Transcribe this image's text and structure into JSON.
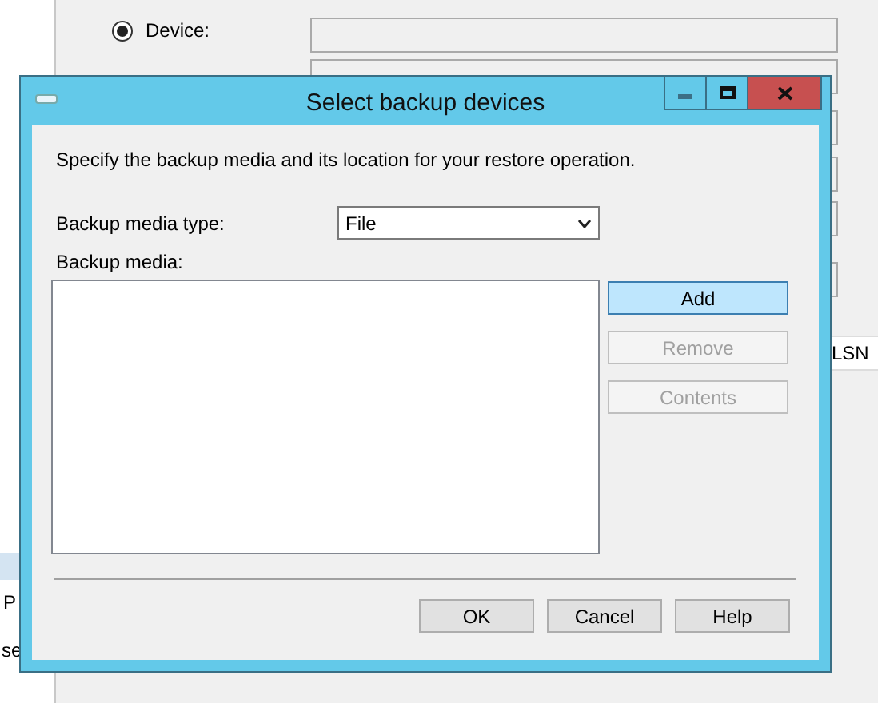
{
  "background": {
    "radio": {
      "label": "Device:",
      "selected": true
    },
    "fragments": [
      {
        "kind": "left",
        "text": "P"
      },
      {
        "kind": "left",
        "text": "se"
      },
      {
        "kind": "header",
        "text": "LSN"
      }
    ]
  },
  "dialog": {
    "title": "Select backup devices",
    "description": "Specify the backup media and its location for your restore operation.",
    "media_type": {
      "label": "Backup media type:",
      "value": "File"
    },
    "media_list": {
      "label": "Backup media:"
    },
    "side_buttons": [
      {
        "label": "Add",
        "disabled": false,
        "highlighted": true
      },
      {
        "label": "Remove",
        "disabled": true,
        "highlighted": false
      },
      {
        "label": "Contents",
        "disabled": true,
        "highlighted": false
      }
    ],
    "footer_buttons": [
      "OK",
      "Cancel",
      "Help"
    ]
  }
}
